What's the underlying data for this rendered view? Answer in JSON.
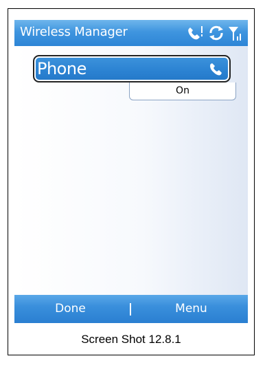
{
  "window": {
    "title": "Wireless Manager"
  },
  "status_bar": {
    "icons": [
      "phone-call-icon",
      "sync-icon",
      "signal-strength-icon"
    ]
  },
  "items": [
    {
      "label": "Phone",
      "icon": "phone-icon",
      "status": "On"
    }
  ],
  "softkeys": {
    "left": "Done",
    "right": "Menu"
  },
  "caption": "Screen Shot 12.8.1",
  "colors": {
    "accent": "#2d85d6",
    "selected": "#2b82d2",
    "text_light": "#ffffff"
  }
}
